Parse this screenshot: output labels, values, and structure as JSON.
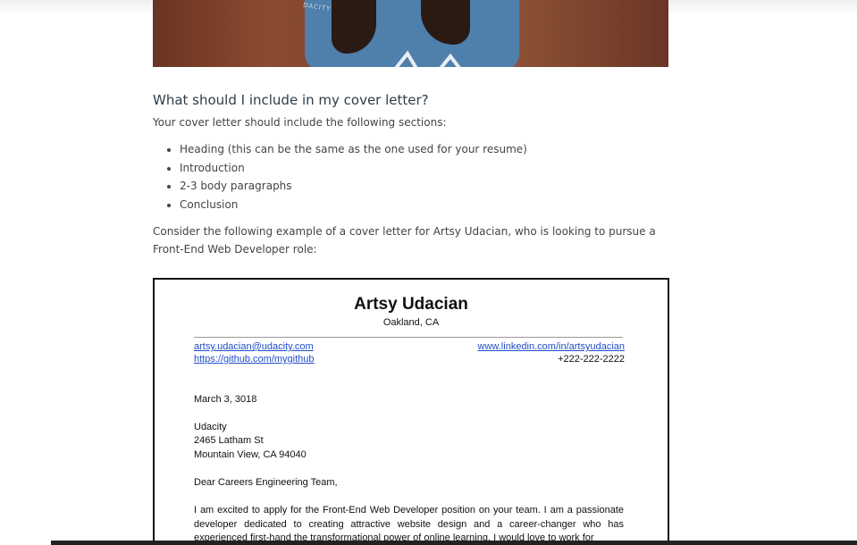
{
  "heading": "What should I include in my cover letter?",
  "intro": "Your cover letter should include the following sections:",
  "sections": [
    "Heading (this can be the same as the one used for your resume)",
    "Introduction",
    "2-3 body paragraphs",
    "Conclusion"
  ],
  "consider_text": "Consider the following example of a cover letter for Artsy Udacian, who is looking to pursue a Front-End Web Developer role:",
  "hero": {
    "shirt_text": "DACITY"
  },
  "letter": {
    "name": "Artsy Udacian",
    "city": "Oakland, CA",
    "email": "artsy.udacian@udacity.com",
    "github": "https://github.com/mygithub",
    "linkedin": "www.linkedin.com/in/artsyudacian",
    "phone": "+222-222-2222",
    "date": "March 3, 3018",
    "recipient_org": "Udacity",
    "recipient_street": "2465 Latham St",
    "recipient_city": "Mountain View, CA 94040",
    "salutation": "Dear Careers Engineering Team,",
    "body": "I am excited to apply for the Front-End Web Developer position on your team. I am a passionate developer dedicated to creating attractive website design and a career-changer who has experienced first-hand the transformational power of online learning. I would love to work for"
  }
}
